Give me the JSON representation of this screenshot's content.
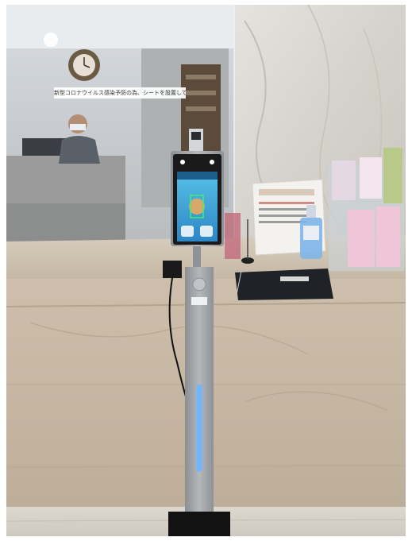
{
  "photo": {
    "partition_caption": "新型コロナウイルス感染予防の為、シートを設置しています",
    "colors": {
      "counter": "#c8b9a4",
      "wall_marble": "#ddd8d0",
      "floor": "#d6d1c9",
      "stand": "#9ea2a6",
      "led_strip": "#6fb8ff",
      "screen_bezel": "#1a1a1a",
      "screen_display": "#3aa0d8"
    }
  }
}
